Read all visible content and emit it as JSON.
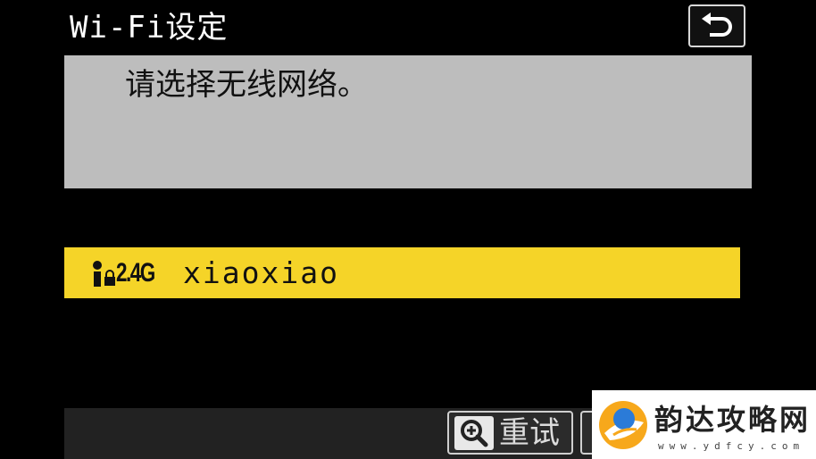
{
  "header": {
    "title": "Wi-Fi设定",
    "back_icon": "return-arrow-icon"
  },
  "message": {
    "text": "请选择无线网络。"
  },
  "networks": [
    {
      "band": "2.4G",
      "ssid": "xiaoxiao",
      "selected": true,
      "icons": [
        "signal-strength-icon",
        "lock-icon"
      ]
    }
  ],
  "footer": {
    "retry_label": "重试",
    "retry_icon": "zoom-in-icon"
  },
  "watermark": {
    "name": "韵达攻略网",
    "url": "www.ydfcy.com"
  },
  "colors": {
    "background": "#000000",
    "message_box": "#bdbdbd",
    "highlight": "#f5d428",
    "footer_bar": "#222222"
  }
}
